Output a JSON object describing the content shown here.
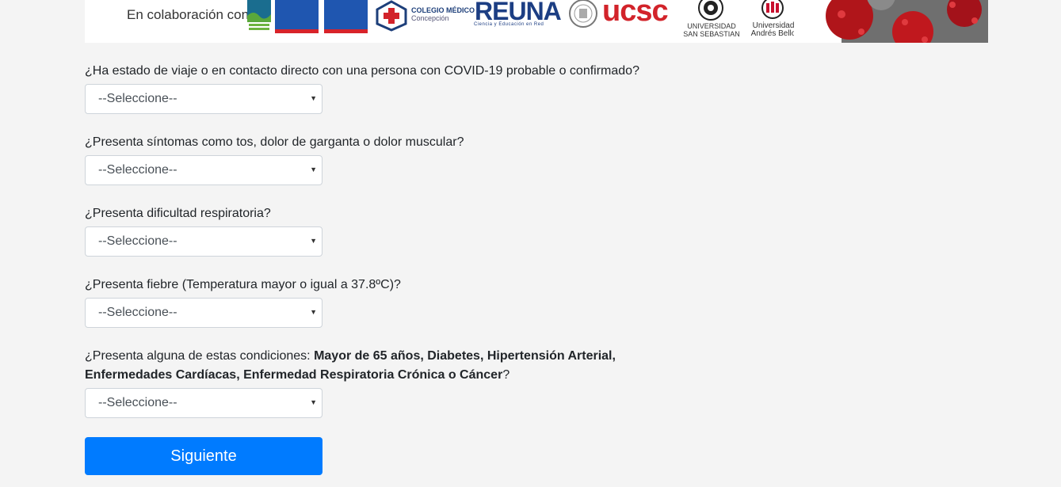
{
  "banner": {
    "collab_label": "En colaboración con:",
    "logos": {
      "colegio_medico_line1": "COLEGIO MÉDICO",
      "colegio_medico_line2": "Concepción",
      "reuna": "REUNA",
      "reuna_sub": "Ciencia y Educación en Red",
      "ucsc": "ucsc",
      "uss_line1": "UNIVERSIDAD",
      "uss_line2": "SAN SEBASTIAN",
      "unab_line1": "Universidad",
      "unab_line2": "Andrés Bello"
    }
  },
  "questions": [
    {
      "label": "¿Ha estado de viaje o en contacto directo con una persona con COVID-19 probable o confirmado?",
      "selected": "--Seleccione--"
    },
    {
      "label": "¿Presenta síntomas como tos, dolor de garganta o dolor muscular?",
      "selected": "--Seleccione--"
    },
    {
      "label": "¿Presenta dificultad respiratoria?",
      "selected": "--Seleccione--"
    },
    {
      "label": "¿Presenta fiebre (Temperatura mayor o igual a 37.8ºC)?",
      "selected": "--Seleccione--"
    },
    {
      "label_prefix": "¿Presenta alguna de estas condiciones: ",
      "label_bold": "Mayor de 65 años, Diabetes, Hipertensión Arterial, Enfermedades Cardíacas, Enfermedad Respiratoria Crónica o Cáncer",
      "label_suffix": "?",
      "selected": "--Seleccione--"
    }
  ],
  "next_button": "Siguiente",
  "colors": {
    "primary": "#007bff",
    "background": "#f4f4f4",
    "gob_blue": "#1f56b0",
    "ucsc_red": "#d2232a"
  }
}
